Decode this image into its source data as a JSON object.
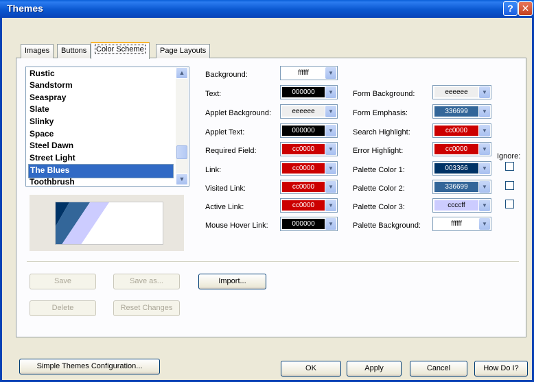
{
  "window": {
    "title": "Themes",
    "help_glyph": "?",
    "close_glyph": "✕"
  },
  "tabs": [
    "Images",
    "Buttons",
    "Color Scheme",
    "Page Layouts"
  ],
  "theme_list": {
    "items": [
      "Rustic",
      "Sandstorm",
      "Seaspray",
      "Slate",
      "Slinky",
      "Space",
      "Steel Dawn",
      "Street Light",
      "The Blues",
      "Toothbrush"
    ],
    "selected": "The Blues"
  },
  "colors": {
    "background": {
      "label": "Background:",
      "value": "ffffff",
      "color": "#ffffff"
    },
    "text": {
      "label": "Text:",
      "value": "000000",
      "color": "#000000"
    },
    "applet_background": {
      "label": "Applet Background:",
      "value": "eeeeee",
      "color": "#eeeeee"
    },
    "applet_text": {
      "label": "Applet Text:",
      "value": "000000",
      "color": "#000000"
    },
    "required_field": {
      "label": "Required Field:",
      "value": "cc0000",
      "color": "#cc0000"
    },
    "link": {
      "label": "Link:",
      "value": "cc0000",
      "color": "#cc0000"
    },
    "visited_link": {
      "label": "Visited Link:",
      "value": "cc0000",
      "color": "#cc0000"
    },
    "active_link": {
      "label": "Active Link:",
      "value": "cc0000",
      "color": "#cc0000"
    },
    "mouse_hover_link": {
      "label": "Mouse Hover Link:",
      "value": "000000",
      "color": "#000000"
    },
    "form_background": {
      "label": "Form Background:",
      "value": "eeeeee",
      "color": "#eeeeee"
    },
    "form_emphasis": {
      "label": "Form Emphasis:",
      "value": "336699",
      "color": "#336699"
    },
    "search_highlight": {
      "label": "Search Highlight:",
      "value": "cc0000",
      "color": "#cc0000"
    },
    "error_highlight": {
      "label": "Error Highlight:",
      "value": "cc0000",
      "color": "#cc0000"
    },
    "palette_color_1": {
      "label": "Palette Color 1:",
      "value": "003366",
      "color": "#003366"
    },
    "palette_color_2": {
      "label": "Palette Color 2:",
      "value": "336699",
      "color": "#336699"
    },
    "palette_color_3": {
      "label": "Palette Color 3:",
      "value": "ccccff",
      "color": "#ccccff"
    },
    "palette_background": {
      "label": "Palette Background:",
      "value": "ffffff",
      "color": "#ffffff"
    }
  },
  "ignore_label": "Ignore:",
  "ignore_checks": [
    false,
    false,
    false
  ],
  "buttons": {
    "save": "Save",
    "save_as": "Save as...",
    "import": "Import...",
    "delete": "Delete",
    "reset_changes": "Reset Changes",
    "simple_config": "Simple Themes Configuration...",
    "ok": "OK",
    "apply": "Apply",
    "cancel": "Cancel",
    "how_do_i": "How Do I?"
  }
}
